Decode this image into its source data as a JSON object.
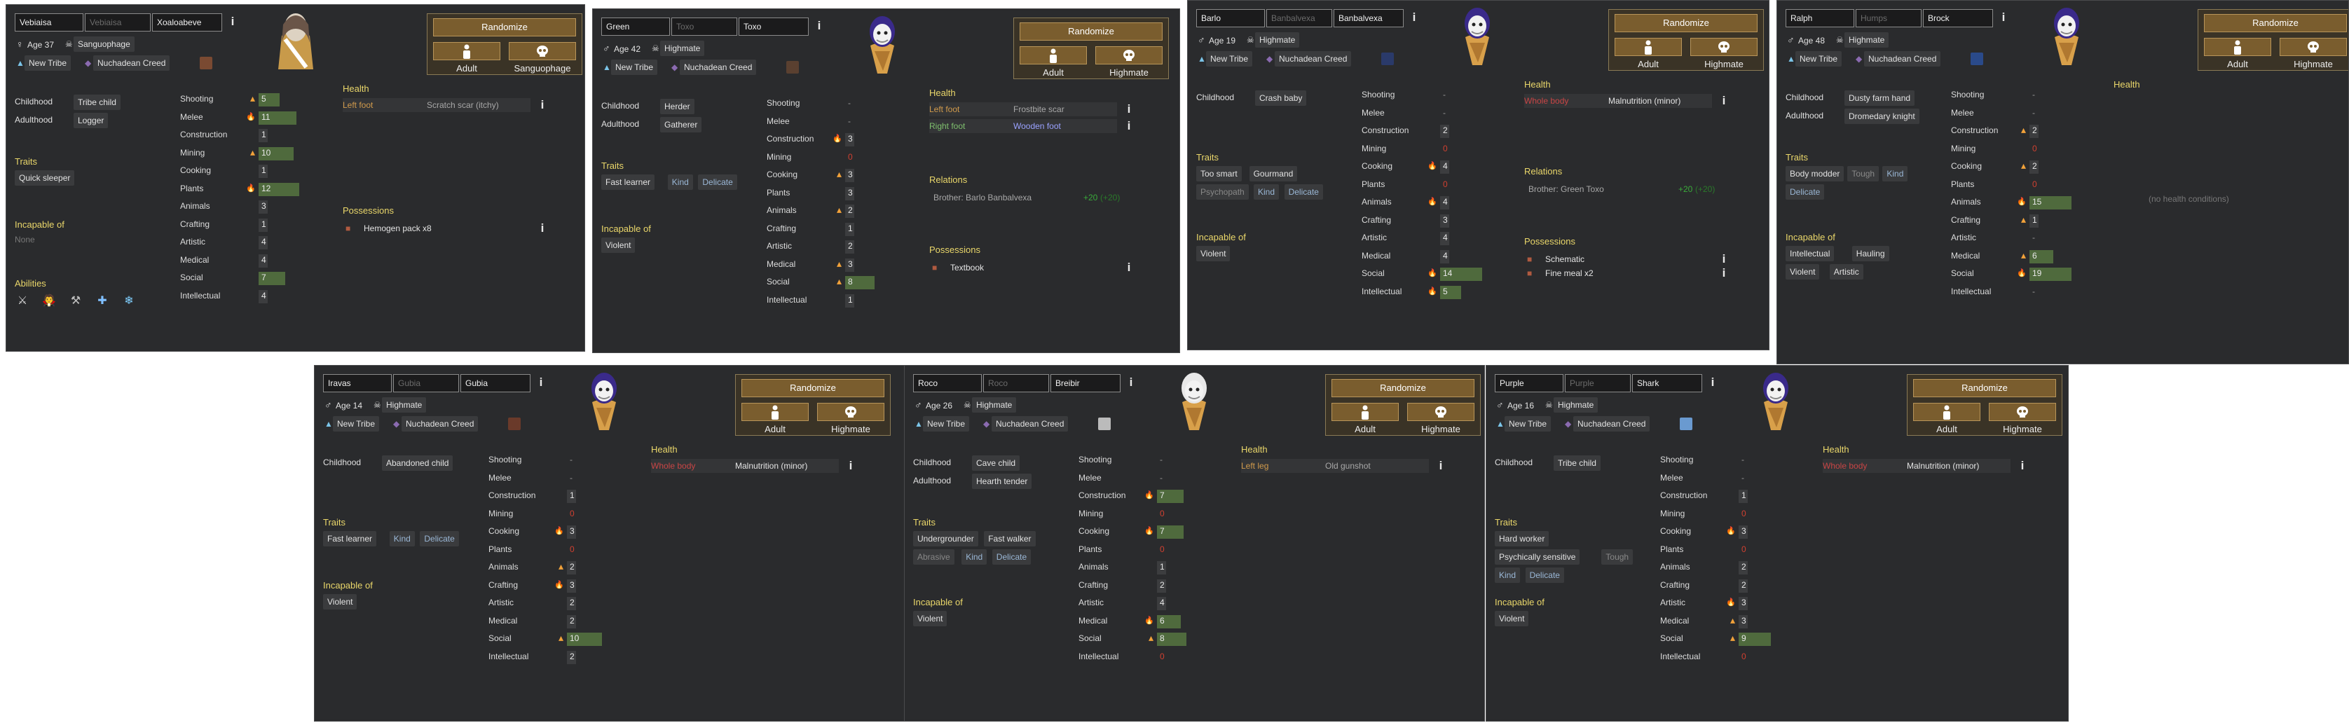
{
  "common": {
    "randomize": "Randomize",
    "adult": "Adult",
    "childhood_label": "Childhood",
    "adulthood_label": "Adulthood",
    "traits_label": "Traits",
    "incapable_label": "Incapable of",
    "abilities_label": "Abilities",
    "health_label": "Health",
    "relations_label": "Relations",
    "possessions_label": "Possessions",
    "faction": "New Tribe",
    "ideo": "Nuchadean Creed",
    "skill_names": [
      "Shooting",
      "Melee",
      "Construction",
      "Mining",
      "Cooking",
      "Plants",
      "Animals",
      "Crafting",
      "Artistic",
      "Medical",
      "Social",
      "Intellectual"
    ]
  },
  "pawns": [
    {
      "first": "Vebiaisa",
      "nick": "Vebiaisa",
      "last": "Xoaloabeve",
      "gender": "female",
      "age": "Age 37",
      "xeno": "Sanguophage",
      "fav_color": "#7a4a32",
      "childhood": "Tribe child",
      "adulthood": "Logger",
      "traits": [
        "Quick sleeper"
      ],
      "incapable": [
        "None"
      ],
      "skills": [
        [
          "5",
          1
        ],
        [
          "11",
          2
        ],
        [
          "1",
          0
        ],
        [
          "10",
          1
        ],
        [
          "1",
          0
        ],
        [
          "12",
          2
        ],
        [
          "3",
          0
        ],
        [
          "1",
          0
        ],
        [
          "4",
          0
        ],
        [
          "4",
          0
        ],
        [
          "7",
          0
        ],
        [
          "4",
          0
        ]
      ],
      "health": [
        [
          "Left foot",
          "Scratch scar (itchy)"
        ]
      ],
      "possessions": [
        "Hemogen pack x8"
      ],
      "abilities": [
        "bow-ability-icon",
        "bite-ability-icon",
        "spear-ability-icon",
        "heal-ability-icon",
        "coagulate-ability-icon"
      ]
    },
    {
      "first": "Green",
      "nick": "Toxo",
      "last": "Toxo",
      "gender": "male",
      "age": "Age 42",
      "xeno": "Highmate",
      "fav_color": "#5a4030",
      "childhood": "Herder",
      "adulthood": "Gatherer",
      "traits": [
        "Fast learner",
        "Kind",
        "Delicate"
      ],
      "incapable": [
        "Violent"
      ],
      "skills": [
        [
          "-",
          0
        ],
        [
          "-",
          0
        ],
        [
          "3",
          2
        ],
        [
          "0",
          0
        ],
        [
          "3",
          1
        ],
        [
          "3",
          0
        ],
        [
          "2",
          1
        ],
        [
          "1",
          0
        ],
        [
          "2",
          0
        ],
        [
          "3",
          1
        ],
        [
          "8",
          1
        ],
        [
          "1",
          0
        ]
      ],
      "health": [
        [
          "Left foot",
          "Frostbite scar"
        ],
        [
          "Right foot",
          "Wooden foot"
        ]
      ],
      "relations": [
        [
          "Brother: Barlo Banbalvexa",
          "+20",
          "(+20)"
        ]
      ],
      "possessions": [
        "Textbook"
      ]
    },
    {
      "first": "Barlo",
      "nick": "Banbalvexa",
      "last": "Banbalvexa",
      "gender": "male",
      "age": "Age 19",
      "xeno": "Highmate",
      "fav_color": "#2a3a6a",
      "childhood": "Crash baby",
      "traits": [
        "Too smart",
        "Gourmand",
        "Psychopath",
        "Kind",
        "Delicate"
      ],
      "incapable": [
        "Violent"
      ],
      "skills": [
        [
          "-",
          0
        ],
        [
          "-",
          0
        ],
        [
          "2",
          0
        ],
        [
          "0",
          0
        ],
        [
          "4",
          2
        ],
        [
          "0",
          0
        ],
        [
          "4",
          2
        ],
        [
          "3",
          0
        ],
        [
          "4",
          0
        ],
        [
          "4",
          0
        ],
        [
          "14",
          2
        ],
        [
          "5",
          2
        ]
      ],
      "health": [
        [
          "Whole body",
          "Malnutrition (minor)"
        ]
      ],
      "relations": [
        [
          "Brother: Green Toxo",
          "+20",
          "(+20)"
        ]
      ],
      "possessions": [
        "Schematic",
        "Fine meal x2"
      ]
    },
    {
      "first": "Ralph",
      "nick": "Humps",
      "last": "Brock",
      "gender": "male",
      "age": "Age 48",
      "xeno": "Highmate",
      "fav_color": "#2a4a8a",
      "childhood": "Dusty farm hand",
      "adulthood": "Dromedary knight",
      "traits": [
        "Body modder",
        "Tough",
        "Kind",
        "Delicate"
      ],
      "incapable": [
        "Intellectual",
        "Hauling",
        "Violent",
        "Artistic"
      ],
      "skills": [
        [
          "-",
          0
        ],
        [
          "-",
          0
        ],
        [
          "2",
          1
        ],
        [
          "0",
          0
        ],
        [
          "2",
          1
        ],
        [
          "0",
          0
        ],
        [
          "15",
          2
        ],
        [
          "1",
          1
        ],
        [
          "-",
          0
        ],
        [
          "6",
          1
        ],
        [
          "19",
          2
        ],
        [
          "-",
          0
        ]
      ],
      "health_none": "(no health conditions)"
    },
    {
      "first": "Iravas",
      "nick": "Gubia",
      "last": "Gubia",
      "gender": "male",
      "age": "Age 14",
      "xeno": "Highmate",
      "fav_color": "#6a3a2a",
      "childhood": "Abandoned child",
      "traits": [
        "Fast learner",
        "Kind",
        "Delicate"
      ],
      "incapable": [
        "Violent"
      ],
      "skills": [
        [
          "-",
          0
        ],
        [
          "-",
          0
        ],
        [
          "1",
          0
        ],
        [
          "0",
          0
        ],
        [
          "3",
          2
        ],
        [
          "0",
          0
        ],
        [
          "2",
          1
        ],
        [
          "3",
          2
        ],
        [
          "2",
          0
        ],
        [
          "2",
          0
        ],
        [
          "10",
          1
        ],
        [
          "2",
          0
        ]
      ],
      "health": [
        [
          "Whole body",
          "Malnutrition (minor)"
        ]
      ]
    },
    {
      "first": "Roco",
      "nick": "Roco",
      "last": "Breibir",
      "gender": "male",
      "age": "Age 26",
      "xeno": "Highmate",
      "fav_color": "#bbbbbb",
      "childhood": "Cave child",
      "adulthood": "Hearth tender",
      "traits": [
        "Undergrounder",
        "Fast walker",
        "Abrasive",
        "Kind",
        "Delicate"
      ],
      "incapable": [
        "Violent"
      ],
      "skills": [
        [
          "-",
          0
        ],
        [
          "-",
          0
        ],
        [
          "7",
          2
        ],
        [
          "0",
          0
        ],
        [
          "7",
          2
        ],
        [
          "0",
          0
        ],
        [
          "1",
          0
        ],
        [
          "2",
          0
        ],
        [
          "4",
          0
        ],
        [
          "6",
          2
        ],
        [
          "8",
          1
        ],
        [
          "0",
          0
        ]
      ],
      "health": [
        [
          "Left leg",
          "Old gunshot"
        ]
      ]
    },
    {
      "first": "Purple",
      "nick": "Purple",
      "last": "Shark",
      "gender": "male",
      "age": "Age 16",
      "xeno": "Highmate",
      "fav_color": "#6a9ad0",
      "childhood": "Tribe child",
      "traits": [
        "Hard worker",
        "Psychically sensitive",
        "Tough",
        "Kind",
        "Delicate"
      ],
      "incapable": [
        "Violent"
      ],
      "skills": [
        [
          "-",
          0
        ],
        [
          "-",
          0
        ],
        [
          "1",
          0
        ],
        [
          "0",
          0
        ],
        [
          "3",
          2
        ],
        [
          "0",
          0
        ],
        [
          "2",
          0
        ],
        [
          "2",
          0
        ],
        [
          "3",
          2
        ],
        [
          "3",
          1
        ],
        [
          "9",
          1
        ],
        [
          "0",
          0
        ]
      ],
      "health": [
        [
          "Whole body",
          "Malnutrition (minor)"
        ]
      ]
    }
  ]
}
